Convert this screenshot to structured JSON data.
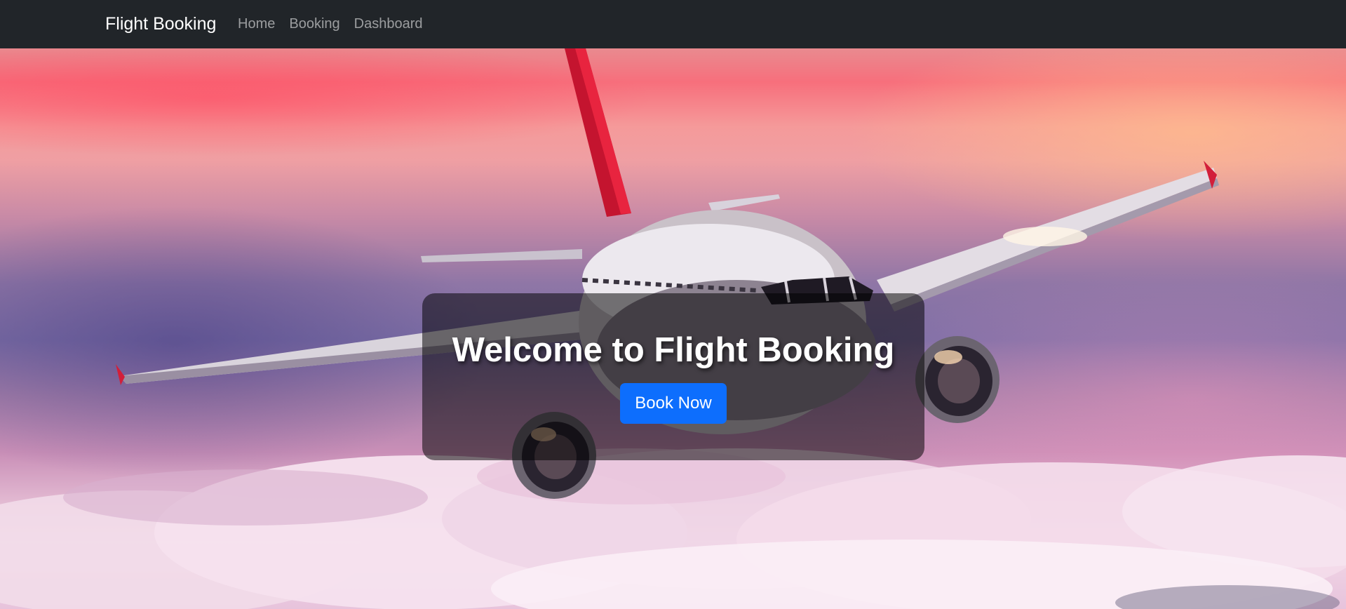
{
  "navbar": {
    "brand": "Flight Booking",
    "links": [
      {
        "label": "Home"
      },
      {
        "label": "Booking"
      },
      {
        "label": "Dashboard"
      }
    ],
    "background_color": "#212529"
  },
  "hero": {
    "title": "Welcome to Flight Booking",
    "cta_label": "Book Now",
    "cta_color": "#0d6efd",
    "background_image": "airplane-flying-above-clouds-at-sunset"
  }
}
